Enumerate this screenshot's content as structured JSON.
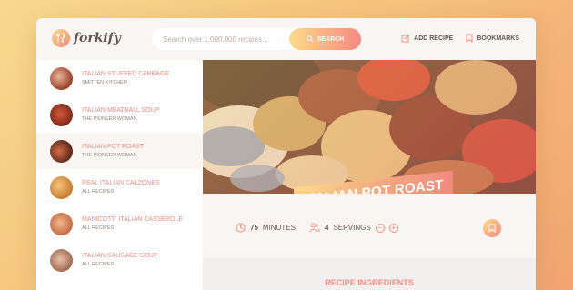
{
  "app": {
    "logo_text": "forkify"
  },
  "search": {
    "placeholder": "Search over 1,000,000 recipes...",
    "button_label": "SEARCH"
  },
  "nav": {
    "add_recipe": "ADD RECIPE",
    "bookmarks": "BOOKMARKS"
  },
  "sidebar": {
    "items": [
      {
        "title": "ITALIAN STUFFED CABBAGE",
        "publisher": "SMITTEN KITCHEN",
        "active": false
      },
      {
        "title": "ITALIAN MEATBALL SOUP",
        "publisher": "THE PIONEER WOMAN",
        "active": false
      },
      {
        "title": "ITALIAN POT ROAST",
        "publisher": "THE PIONEER WOMAN",
        "active": true
      },
      {
        "title": "REAL ITALIAN CALZONES",
        "publisher": "ALL RECIPES",
        "active": false
      },
      {
        "title": "MANICOTTI ITALIAN CASSEROLE",
        "publisher": "ALL RECIPES",
        "active": false
      },
      {
        "title": "ITALIAN SAUSAGE SOUP",
        "publisher": "ALL RECIPES",
        "active": false
      }
    ]
  },
  "recipe": {
    "title": "ITALIAN POT ROAST",
    "minutes": "75",
    "minutes_label": "MINUTES",
    "servings": "4",
    "servings_label": "SERVINGS",
    "ingredients_heading": "RECIPE INGREDIENTS"
  },
  "colors": {
    "accent_start": "#fbdb89",
    "accent_end": "#f48982",
    "text": "#615551"
  },
  "icons": {
    "logo": "fork-knife-icon",
    "search": "search-icon",
    "add_recipe": "edit-icon",
    "bookmarks": "bookmark-icon",
    "time": "clock-icon",
    "servings": "users-icon",
    "decrease": "minus-circle-icon",
    "increase": "plus-circle-icon",
    "bookmark_button": "bookmark-icon"
  }
}
